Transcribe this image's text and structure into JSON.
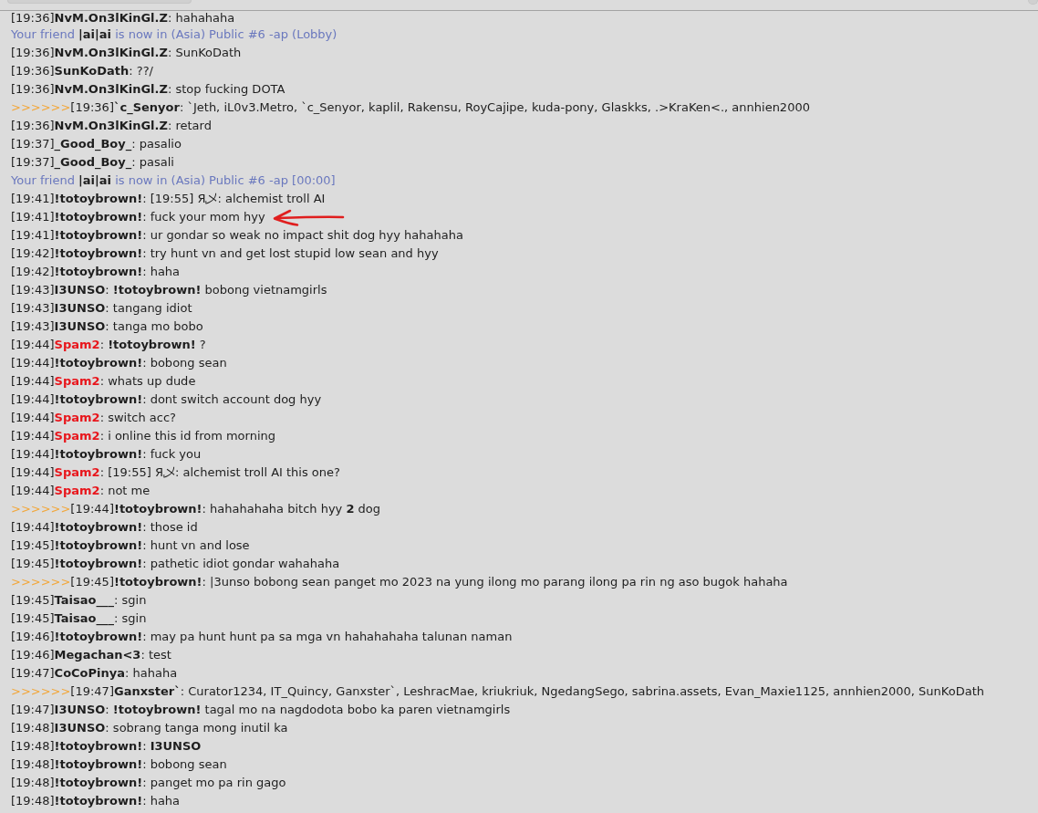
{
  "messages": [
    {
      "kind": "chat",
      "time": "[19:36]",
      "user": "NvM.On3lKinGl.Z",
      "text": ": hahahaha",
      "annotated": false
    },
    {
      "kind": "notice",
      "text": "Your friend **|ai|ai** is now in (Asia) Public #6 -ap (Lobby)",
      "annotated": false
    },
    {
      "kind": "chat",
      "time": "[19:36]",
      "user": "NvM.On3lKinGl.Z",
      "text": ": SunKoDath",
      "annotated": false
    },
    {
      "kind": "chat",
      "time": "[19:36]",
      "user": "SunKoDath",
      "text": ": ??/",
      "annotated": false
    },
    {
      "kind": "chat",
      "time": "[19:36]",
      "user": "NvM.On3lKinGl.Z",
      "text": ": stop fucking DOTA",
      "annotated": false
    },
    {
      "kind": "chat",
      "prefix": ">>>>>>",
      "time": "[19:36]",
      "user": "`c_Senyor",
      "text": ": `Jeth, iL0v3.Metro, `c_Senyor, kaplil, Rakensu, RoyCajipe, kuda-pony, Glaskks, .>KraKen<., annhien2000",
      "annotated": false
    },
    {
      "kind": "chat",
      "time": "[19:36]",
      "user": "NvM.On3lKinGl.Z",
      "text": ": retard",
      "annotated": false
    },
    {
      "kind": "chat",
      "time": "[19:37]",
      "user": "_Good_Boy_",
      "text": ": pasalio",
      "annotated": false
    },
    {
      "kind": "chat",
      "time": "[19:37]",
      "user": "_Good_Boy_",
      "text": ": pasali",
      "annotated": false
    },
    {
      "kind": "notice",
      "text": "Your friend **|ai|ai** is now in (Asia) Public #6 -ap [00:00]",
      "annotated": false
    },
    {
      "kind": "chat",
      "time": "[19:41]",
      "user": "!totoybrown!",
      "text": ": [19:55] Я乄: alchemist troll AI",
      "annotated": false
    },
    {
      "kind": "chat",
      "time": "[19:41]",
      "user": "!totoybrown!",
      "text": ": fuck your mom hyy",
      "annotated": true
    },
    {
      "kind": "chat",
      "time": "[19:41]",
      "user": "!totoybrown!",
      "text": ": ur gondar so weak no impact shit dog hyy hahahaha",
      "annotated": false
    },
    {
      "kind": "chat",
      "time": "[19:42]",
      "user": "!totoybrown!",
      "text": ": try hunt vn and get lost stupid low sean and hyy",
      "annotated": false
    },
    {
      "kind": "chat",
      "time": "[19:42]",
      "user": "!totoybrown!",
      "text": ": haha",
      "annotated": false
    },
    {
      "kind": "chat",
      "time": "[19:43]",
      "user": "I3UNSO",
      "text": ": **!totoybrown!** bobong vietnamgirls",
      "annotated": false
    },
    {
      "kind": "chat",
      "time": "[19:43]",
      "user": "I3UNSO",
      "text": ": tangang idiot",
      "annotated": false
    },
    {
      "kind": "chat",
      "time": "[19:43]",
      "user": "I3UNSO",
      "text": ": tanga mo bobo",
      "annotated": false
    },
    {
      "kind": "chat",
      "time": "[19:44]",
      "user": "Spam2",
      "color": "#e8161c",
      "text": ": **!totoybrown!** ?",
      "annotated": false
    },
    {
      "kind": "chat",
      "time": "[19:44]",
      "user": "!totoybrown!",
      "text": ": bobong sean",
      "annotated": false
    },
    {
      "kind": "chat",
      "time": "[19:44]",
      "user": "Spam2",
      "color": "#e8161c",
      "text": ": whats up dude",
      "annotated": false
    },
    {
      "kind": "chat",
      "time": "[19:44]",
      "user": "!totoybrown!",
      "text": ": dont switch account dog hyy",
      "annotated": false
    },
    {
      "kind": "chat",
      "time": "[19:44]",
      "user": "Spam2",
      "color": "#e8161c",
      "text": ": switch acc?",
      "annotated": false
    },
    {
      "kind": "chat",
      "time": "[19:44]",
      "user": "Spam2",
      "color": "#e8161c",
      "text": ": i online this id from morning",
      "annotated": false
    },
    {
      "kind": "chat",
      "time": "[19:44]",
      "user": "!totoybrown!",
      "text": ": fuck you",
      "annotated": false
    },
    {
      "kind": "chat",
      "time": "[19:44]",
      "user": "Spam2",
      "color": "#e8161c",
      "text": ": [19:55] Я乄: alchemist troll AI this one?",
      "annotated": false
    },
    {
      "kind": "chat",
      "time": "[19:44]",
      "user": "Spam2",
      "color": "#e8161c",
      "text": ": not me",
      "annotated": false
    },
    {
      "kind": "chat",
      "prefix": ">>>>>>",
      "time": "[19:44]",
      "user": "!totoybrown!",
      "text": ": hahahahaha bitch hyy **2** dog",
      "annotated": false
    },
    {
      "kind": "chat",
      "time": "[19:44]",
      "user": "!totoybrown!",
      "text": ": those id",
      "annotated": false
    },
    {
      "kind": "chat",
      "time": "[19:45]",
      "user": "!totoybrown!",
      "text": ": hunt vn and lose",
      "annotated": false
    },
    {
      "kind": "chat",
      "time": "[19:45]",
      "user": "!totoybrown!",
      "text": ": pathetic idiot gondar wahahaha",
      "annotated": false
    },
    {
      "kind": "chat",
      "prefix": ">>>>>>",
      "time": "[19:45]",
      "user": "!totoybrown!",
      "text": ": |3unso bobong sean panget mo 2023 na yung ilong mo parang ilong pa rin ng aso bugok hahaha",
      "annotated": false
    },
    {
      "kind": "chat",
      "time": "[19:45]",
      "user": "Taisao___",
      "text": ": sgin",
      "annotated": false
    },
    {
      "kind": "chat",
      "time": "[19:45]",
      "user": "Taisao___",
      "text": ": sgin",
      "annotated": false
    },
    {
      "kind": "chat",
      "time": "[19:46]",
      "user": "!totoybrown!",
      "text": ": may pa hunt hunt pa sa mga vn hahahahaha talunan naman",
      "annotated": false
    },
    {
      "kind": "chat",
      "time": "[19:46]",
      "user": "Megachan<3",
      "text": ": test",
      "annotated": false
    },
    {
      "kind": "chat",
      "time": "[19:47]",
      "user": "CoCoPinya",
      "text": ": hahaha",
      "annotated": false
    },
    {
      "kind": "chat",
      "prefix": ">>>>>>",
      "time": "[19:47]",
      "user": "Ganxster`",
      "text": ": Curator1234, IT_Quincy, Ganxster`, LeshracMae, kriukriuk, NgedangSego, sabrina.assets, Evan_Maxie1125, annhien2000, SunKoDath",
      "annotated": false
    },
    {
      "kind": "chat",
      "time": "[19:47]",
      "user": "I3UNSO",
      "text": ": **!totoybrown!** tagal mo na nagdodota bobo ka paren vietnamgirls",
      "annotated": false
    },
    {
      "kind": "chat",
      "time": "[19:48]",
      "user": "I3UNSO",
      "text": ": sobrang tanga mong inutil ka",
      "annotated": false
    },
    {
      "kind": "chat",
      "time": "[19:48]",
      "user": "!totoybrown!",
      "text": ": **I3UNSO**",
      "annotated": false
    },
    {
      "kind": "chat",
      "time": "[19:48]",
      "user": "!totoybrown!",
      "text": ": bobong sean",
      "annotated": false
    },
    {
      "kind": "chat",
      "time": "[19:48]",
      "user": "!totoybrown!",
      "text": ": panget mo pa rin gago",
      "annotated": false
    },
    {
      "kind": "chat",
      "time": "[19:48]",
      "user": "!totoybrown!",
      "text": ": haha",
      "annotated": false
    }
  ]
}
